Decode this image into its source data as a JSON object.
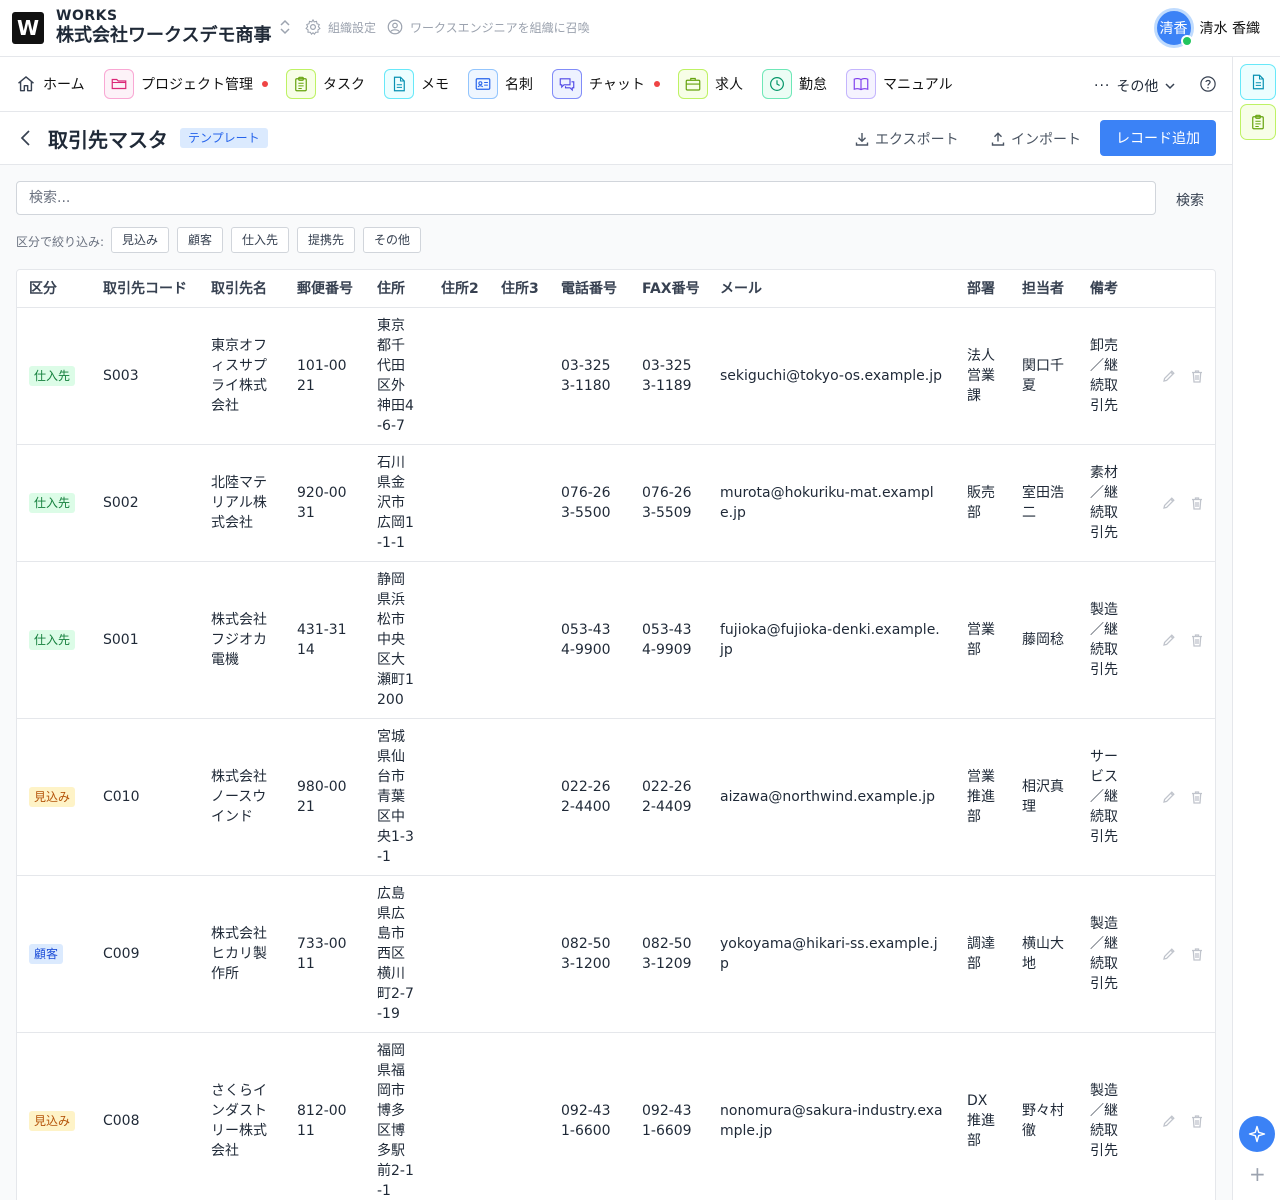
{
  "header": {
    "logo_letter": "W",
    "brand_small": "WORKS",
    "company": "株式会社ワークスデモ商事",
    "org_settings": "組織設定",
    "invite": "ワークスエンジニアを組織に召喚",
    "user_initials": "清香",
    "user_name": "清水 香織"
  },
  "nav": {
    "home": "ホーム",
    "project": "プロジェクト管理",
    "task": "タスク",
    "memo": "メモ",
    "card": "名刺",
    "chat": "チャット",
    "jobs": "求人",
    "attendance": "勤怠",
    "manual": "マニュアル",
    "more": "その他"
  },
  "page": {
    "title": "取引先マスタ",
    "tag": "テンプレート",
    "export": "エクスポート",
    "import": "インポート",
    "add": "レコード追加"
  },
  "search": {
    "placeholder": "検索...",
    "button": "検索"
  },
  "filter": {
    "label": "区分で絞り込み:",
    "chips": [
      "見込み",
      "顧客",
      "仕入先",
      "提携先",
      "その他"
    ]
  },
  "table": {
    "columns": [
      "区分",
      "取引先コード",
      "取引先名",
      "郵便番号",
      "住所",
      "住所2",
      "住所3",
      "電話番号",
      "FAX番号",
      "メール",
      "部署",
      "担当者",
      "備考"
    ],
    "rows": [
      {
        "kind": "仕入先",
        "code": "S003",
        "name": "東京オフィスサプライ株式会社",
        "zip": "101-0021",
        "addr": "東京都千代田区外神田4-6-7",
        "addr2": "",
        "addr3": "",
        "tel": "03-3253-1180",
        "fax": "03-3253-1189",
        "mail": "sekiguchi@tokyo-os.example.jp",
        "dept": "法人営業課",
        "person": "関口千夏",
        "note": "卸売／継続取引先"
      },
      {
        "kind": "仕入先",
        "code": "S002",
        "name": "北陸マテリアル株式会社",
        "zip": "920-0031",
        "addr": "石川県金沢市広岡1-1-1",
        "addr2": "",
        "addr3": "",
        "tel": "076-263-5500",
        "fax": "076-263-5509",
        "mail": "murota@hokuriku-mat.example.jp",
        "dept": "販売部",
        "person": "室田浩二",
        "note": "素材／継続取引先"
      },
      {
        "kind": "仕入先",
        "code": "S001",
        "name": "株式会社フジオカ電機",
        "zip": "431-3114",
        "addr": "静岡県浜松市中央区大瀬町1200",
        "addr2": "",
        "addr3": "",
        "tel": "053-434-9900",
        "fax": "053-434-9909",
        "mail": "fujioka@fujioka-denki.example.jp",
        "dept": "営業部",
        "person": "藤岡稔",
        "note": "製造／継続取引先"
      },
      {
        "kind": "見込み",
        "code": "C010",
        "name": "株式会社ノースウインド",
        "zip": "980-0021",
        "addr": "宮城県仙台市青葉区中央1-3-1",
        "addr2": "",
        "addr3": "",
        "tel": "022-262-4400",
        "fax": "022-262-4409",
        "mail": "aizawa@northwind.example.jp",
        "dept": "営業推進部",
        "person": "相沢真理",
        "note": "サービス／継続取引先"
      },
      {
        "kind": "顧客",
        "code": "C009",
        "name": "株式会社ヒカリ製作所",
        "zip": "733-0011",
        "addr": "広島県広島市西区横川町2-7-19",
        "addr2": "",
        "addr3": "",
        "tel": "082-503-1200",
        "fax": "082-503-1209",
        "mail": "yokoyama@hikari-ss.example.jp",
        "dept": "調達部",
        "person": "横山大地",
        "note": "製造／継続取引先"
      },
      {
        "kind": "見込み",
        "code": "C008",
        "name": "さくらインダストリー株式会社",
        "zip": "812-0011",
        "addr": "福岡県福岡市博多区博多駅前2-1-1",
        "addr2": "",
        "addr3": "",
        "tel": "092-431-6600",
        "fax": "092-431-6609",
        "mail": "nonomura@sakura-industry.example.jp",
        "dept": "DX推進部",
        "person": "野々村徹",
        "note": "製造／継続取引先"
      }
    ]
  },
  "colors": {
    "accent": "#3b82f6",
    "badge_supplier_bg": "#dcfce7",
    "badge_supplier_fg": "#15803d",
    "badge_prospect_bg": "#fef3c7",
    "badge_prospect_fg": "#b45309",
    "badge_customer_bg": "#dbeafe",
    "badge_customer_fg": "#1d4ed8"
  },
  "icons": {
    "row_edit": "pencil-icon",
    "row_delete": "trash-icon"
  }
}
